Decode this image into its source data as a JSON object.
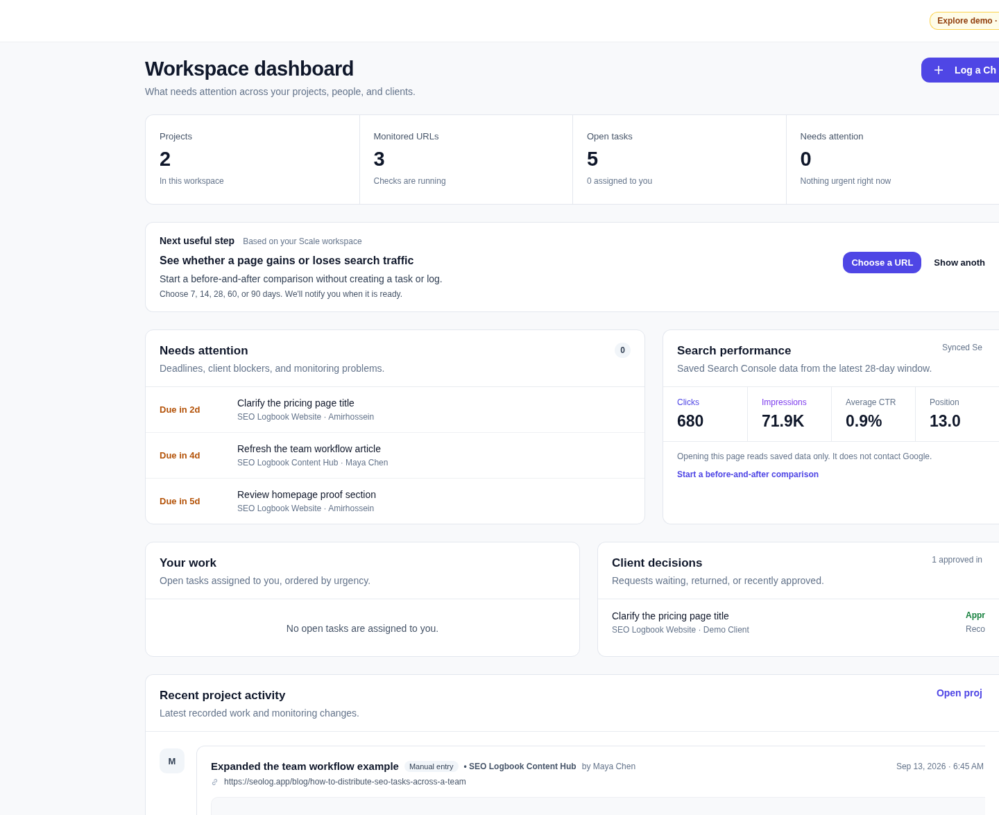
{
  "top_bar": {
    "demo_badge": "Explore demo ·"
  },
  "header": {
    "title": "Workspace dashboard",
    "subtitle": "What needs attention across your projects, people, and clients.",
    "action_button": "Log a Ch"
  },
  "stats": [
    {
      "label": "Projects",
      "value": "2",
      "note": "In this workspace"
    },
    {
      "label": "Monitored URLs",
      "value": "3",
      "note": "Checks are running"
    },
    {
      "label": "Open tasks",
      "value": "5",
      "note": "0 assigned to you"
    },
    {
      "label": "Needs attention",
      "value": "0",
      "note": "Nothing urgent right now"
    }
  ],
  "next_step": {
    "title": "Next useful step",
    "context": "Based on your Scale workspace",
    "headline": "See whether a page gains or loses search traffic",
    "body": "Start a before-and-after comparison without creating a task or log.",
    "note": "Choose 7, 14, 28, 60, or 90 days. We'll notify you when it is ready.",
    "primary_button": "Choose a URL",
    "secondary_button": "Show anoth"
  },
  "needs_attention": {
    "title": "Needs attention",
    "subtitle": "Deadlines, client blockers, and monitoring problems.",
    "count": "0",
    "items": [
      {
        "due": "Due in 2d",
        "title": "Clarify the pricing page title",
        "meta": "SEO Logbook Website · Amirhossein"
      },
      {
        "due": "Due in 4d",
        "title": "Refresh the team workflow article",
        "meta": "SEO Logbook Content Hub · Maya Chen"
      },
      {
        "due": "Due in 5d",
        "title": "Review homepage proof section",
        "meta": "SEO Logbook Website · Amirhossein"
      }
    ]
  },
  "search_performance": {
    "title": "Search performance",
    "subtitle": "Saved Search Console data from the latest 28-day window.",
    "sync_note": "Synced Se",
    "metrics": [
      {
        "label": "Clicks",
        "value": "680",
        "color": "#4f46e5"
      },
      {
        "label": "Impressions",
        "value": "71.9K",
        "color": "#7c3aed"
      },
      {
        "label": "Average CTR",
        "value": "0.9%",
        "color": "#64748b"
      },
      {
        "label": "Position",
        "value": "13.0",
        "color": "#64748b"
      }
    ],
    "note": "Opening this page reads saved data only. It does not contact Google.",
    "link": "Start a before-and-after comparison"
  },
  "your_work": {
    "title": "Your work",
    "subtitle": "Open tasks assigned to you, ordered by urgency.",
    "empty_message": "No open tasks are assigned to you."
  },
  "client_decisions": {
    "title": "Client decisions",
    "subtitle": "Requests waiting, returned, or recently approved.",
    "summary": "1 approved in",
    "items": [
      {
        "kind": "approved",
        "title": "Clarify the pricing page title",
        "meta": "SEO Logbook Website · Demo Client",
        "status": "Appr",
        "status_note": "Reco"
      }
    ]
  },
  "recent_activity": {
    "title": "Recent project activity",
    "subtitle": "Latest recorded work and monitoring changes.",
    "link": "Open proj",
    "entries": [
      {
        "avatar": "M",
        "title": "Expanded the team workflow example",
        "tag": "Manual entry",
        "project": "• SEO Logbook Content Hub",
        "author": "by Maya Chen",
        "time": "Sep 13, 2026 · 6:45 AM",
        "url": "https://seolog.app/blog/how-to-distribute-seo-tasks-across-a-team"
      }
    ]
  }
}
